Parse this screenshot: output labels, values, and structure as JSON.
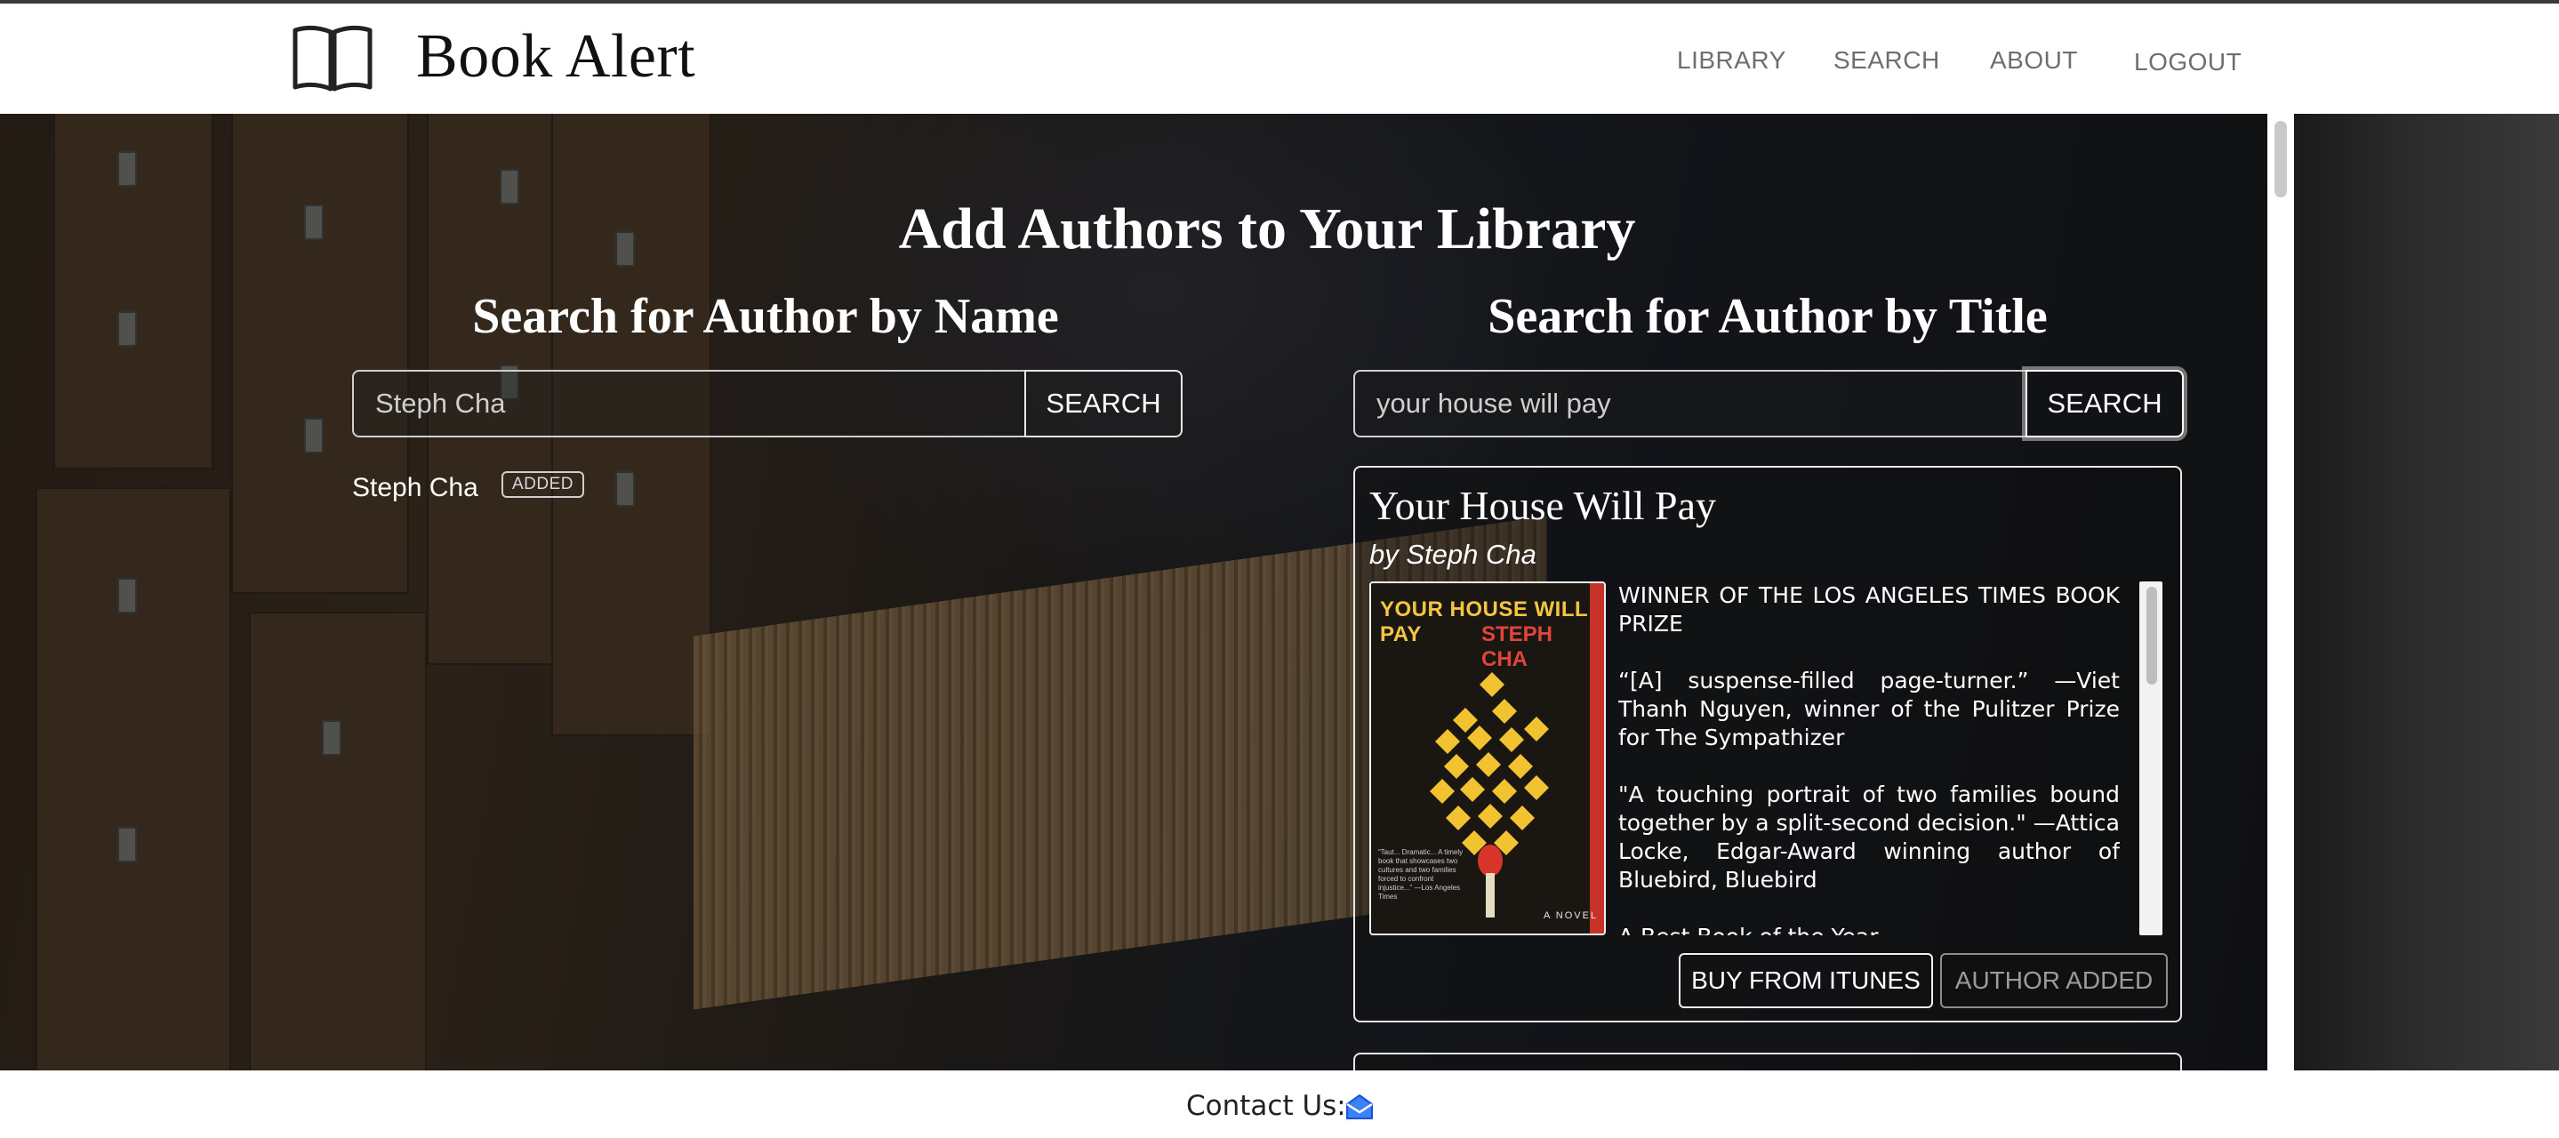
{
  "brand": {
    "name": "Book Alert",
    "logo_icon": "open-book-icon"
  },
  "nav": {
    "items": [
      {
        "label": "LIBRARY"
      },
      {
        "label": "SEARCH"
      },
      {
        "label": "ABOUT"
      },
      {
        "label": "LOGOUT"
      }
    ]
  },
  "hero": {
    "title": "Add Authors to Your Library"
  },
  "search_by_name": {
    "title": "Search for Author by Name",
    "input_value": "Steph Cha",
    "button_label": "SEARCH",
    "results": [
      {
        "name": "Steph Cha",
        "badge": "ADDED"
      }
    ]
  },
  "search_by_title": {
    "title": "Search for Author by Title",
    "input_value": "your house will pay",
    "button_label": "SEARCH"
  },
  "book": {
    "title": "Your House Will Pay",
    "author_line": "by Steph Cha",
    "cover": {
      "title_text": "YOUR HOUSE WILL PAY",
      "author_text": "STEPH CHA",
      "footer_text": "A NOVEL"
    },
    "description": [
      "WINNER OF THE LOS ANGELES TIMES BOOK PRIZE",
      "“[A] suspense-filled page-turner.” —Viet Thanh Nguyen, winner of the Pulitzer Prize for The Sympathizer",
      "\"A touching portrait of two families bound together by a split-second decision.\" —Attica Locke, Edgar-Award winning author of Bluebird, Bluebird",
      "A Best Book of the Year"
    ],
    "buy_button": "BUY FROM ITUNES",
    "added_button": "AUTHOR ADDED"
  },
  "footer": {
    "contact_label": "Contact Us:",
    "contact_icon": "mail-icon"
  },
  "colors": {
    "accent_red": "#c83228",
    "cover_yellow": "#f4c542"
  }
}
